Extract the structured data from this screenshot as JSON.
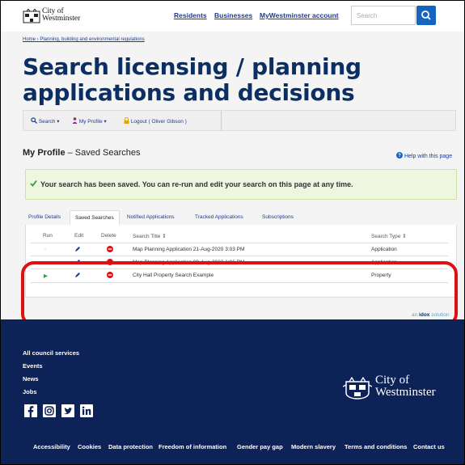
{
  "header": {
    "logo_line1": "City of",
    "logo_line2": "Westminster",
    "nav": [
      "Residents",
      "Businesses",
      "MyWestminster account"
    ],
    "search_placeholder": "Search"
  },
  "breadcrumb": "Home › Planning, building and environmental regulations",
  "page_title": "Search licensing / planning applications and decisions",
  "toolbar": {
    "search_label": "Search",
    "profile_label": "My Profile",
    "logout_label": "Logout  ( Oliver Gibson )"
  },
  "profile_heading_bold": "My Profile",
  "profile_heading_rest": " – Saved Searches",
  "help_link": "Help with this page",
  "alert_message": "Your search has been saved. You can re-run and edit your search on this page at any time.",
  "tabs": [
    "Profile Details",
    "Saved Searches",
    "Notified Applications",
    "Tracked Applications",
    "Subscriptions"
  ],
  "table": {
    "headers": [
      "Run",
      "Edit",
      "Delete",
      "Search Title ⇕",
      "Search Type ⇕"
    ],
    "rows": [
      {
        "run": "-",
        "title": "Map Planning Application 21-Aug-2020 3:03 PM",
        "type": "Application"
      },
      {
        "run": "-",
        "title": "Map Planning Application 09-Aug-2022 1:06 PM",
        "type": "Application"
      },
      {
        "run": "▶",
        "title": "City Hall Property Search Example",
        "type": "Property"
      }
    ]
  },
  "idox": {
    "prefix": "an ",
    "brand": "idox",
    "suffix": " solution"
  },
  "footer": {
    "links": [
      "All council services",
      "Events",
      "News",
      "Jobs"
    ],
    "logo_line1": "City of",
    "logo_line2": "Westminster",
    "bottom_links": [
      "Accessibility",
      "Cookies",
      "Data protection",
      "Freedom of information",
      "Gender pay gap",
      "Modern slavery",
      "Terms and conditions",
      "Contact us"
    ]
  },
  "colors": {
    "primary": "#0b2e63",
    "link": "#1d3c94",
    "footer_bg": "#0d2257",
    "highlight": "#e01010",
    "success": "#2e9e3e"
  }
}
